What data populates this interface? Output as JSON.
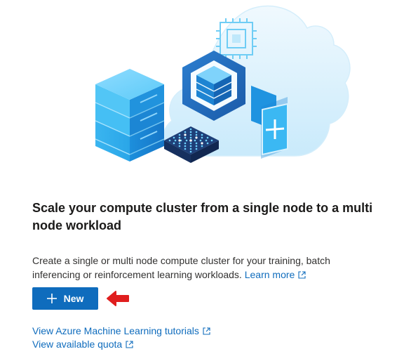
{
  "card": {
    "title": "Scale your compute cluster from a single node to a multi node workload",
    "description": "Create a single or multi node compute cluster for your training, batch inferencing or reinforcement learning workloads.",
    "learn_more_label": "Learn more",
    "new_button_label": "New",
    "links": [
      {
        "label": "View Azure Machine Learning tutorials"
      },
      {
        "label": "View available quota"
      }
    ]
  },
  "icons": {
    "hero": "compute-cluster-illustration",
    "plus": "plus-icon",
    "external": "external-link-icon",
    "arrow": "red-arrow-icon"
  },
  "colors": {
    "accent": "#0f6cbd",
    "arrow": "#e01e1e",
    "cloud": "#e3f4fd",
    "server": "#3cb7f2"
  }
}
